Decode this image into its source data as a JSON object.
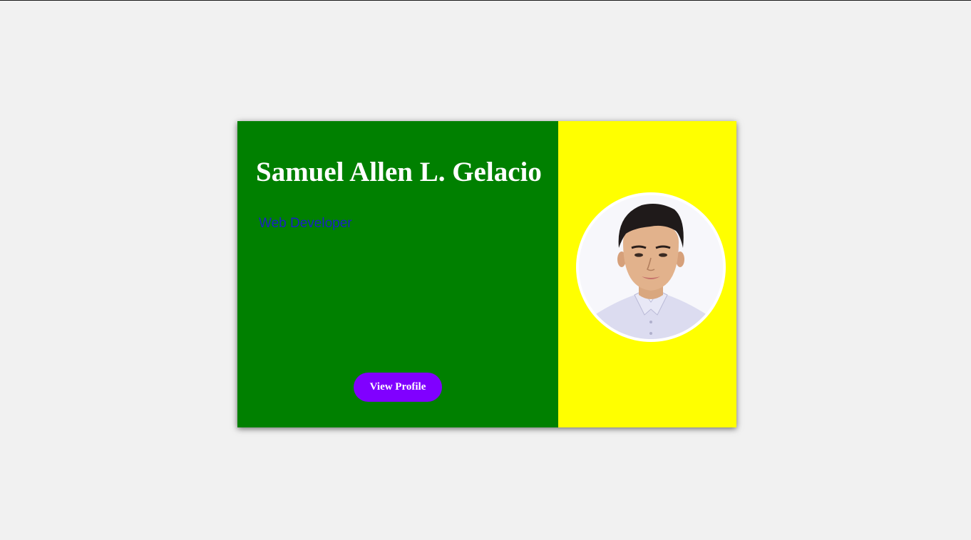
{
  "card": {
    "name": "Samuel Allen L. Gelacio",
    "role": "Web Developer",
    "button_label": "View Profile",
    "avatar_icon": "profile-photo"
  },
  "colors": {
    "page_background": "#f1f1f1",
    "left_panel": "#008000",
    "right_panel": "#ffff00",
    "name_text": "#ffffff",
    "role_text": "#1b21c4",
    "button": "#8000ff"
  }
}
